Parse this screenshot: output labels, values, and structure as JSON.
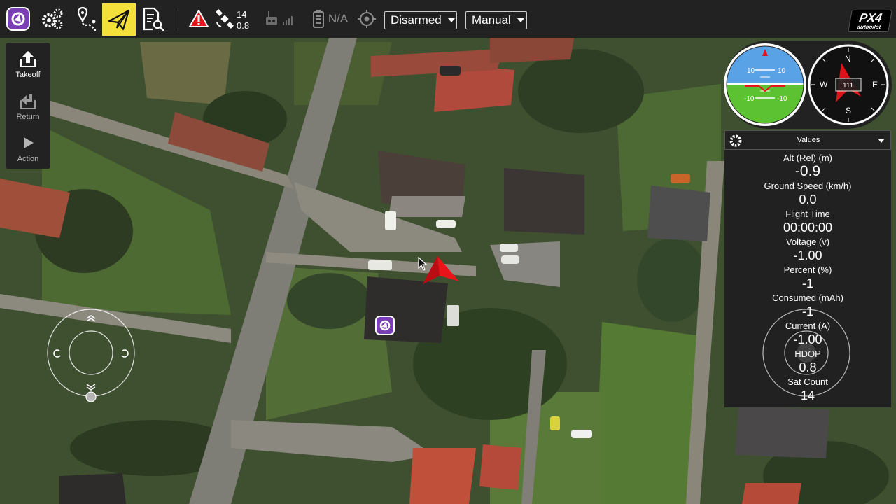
{
  "toolbar": {
    "gps": {
      "satellites": "14",
      "hdop": "0.8"
    },
    "battery": {
      "text": "N/A"
    },
    "armed_mode": "Disarmed",
    "flight_mode": "Manual",
    "logo": {
      "brand": "PX4",
      "sub": "autopilot"
    }
  },
  "toolstrip": {
    "items": [
      {
        "label": "Takeoff",
        "icon": "takeoff-icon"
      },
      {
        "label": "Return",
        "icon": "return-icon"
      },
      {
        "label": "Action",
        "icon": "play-icon"
      }
    ]
  },
  "instruments": {
    "attitude": {
      "pitch_marks": [
        "10",
        "10",
        "-10",
        "-10"
      ]
    },
    "compass": {
      "heading": "111",
      "cardinals": {
        "n": "N",
        "e": "E",
        "s": "S",
        "w": "W"
      }
    }
  },
  "values": {
    "title": "Values",
    "rows": [
      {
        "label": "Alt (Rel) (m)",
        "value": "-0.9"
      },
      {
        "label": "Ground Speed (km/h)",
        "value": "0.0"
      },
      {
        "label": "Flight Time",
        "value": "00:00:00"
      },
      {
        "label": "Voltage (v)",
        "value": "-1.00"
      },
      {
        "label": "Percent (%)",
        "value": "-1"
      },
      {
        "label": "Consumed (mAh)",
        "value": "-1"
      },
      {
        "label": "Current (A)",
        "value": "-1.00"
      },
      {
        "label": "HDOP",
        "value": "0.8"
      },
      {
        "label": "Sat Count",
        "value": "14"
      }
    ]
  },
  "colors": {
    "toolbar_bg": "#222222",
    "fly_active": "#f4e03a",
    "warning_red": "#e5141b",
    "vehicle_red": "#e8141a",
    "qgc_purple": "#7a3fb5",
    "sky_blue": "#5aa2e6",
    "ground_green": "#5cc232"
  }
}
